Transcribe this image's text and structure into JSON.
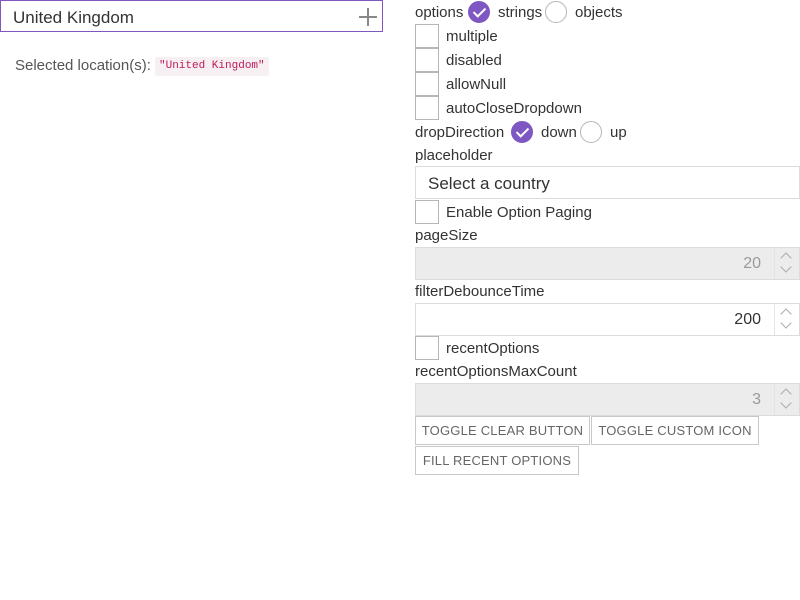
{
  "combobox": {
    "value": "United Kingdom",
    "add_icon": "plus-icon"
  },
  "selection": {
    "label": "Selected location(s):",
    "badge": "\"United Kingdom\""
  },
  "options": {
    "label": "options",
    "choices": [
      {
        "label": "strings",
        "checked": true
      },
      {
        "label": "objects",
        "checked": false
      }
    ]
  },
  "checkboxes": {
    "multiple": "multiple",
    "disabled": "disabled",
    "allowNull": "allowNull",
    "autoCloseDropdown": "autoCloseDropdown"
  },
  "dropDirection": {
    "label": "dropDirection",
    "choices": [
      {
        "label": "down",
        "checked": true
      },
      {
        "label": "up",
        "checked": false
      }
    ]
  },
  "placeholder": {
    "label": "placeholder",
    "value": "Select a country"
  },
  "paging": {
    "label": "Enable Option Paging",
    "checked": false
  },
  "pageSize": {
    "label": "pageSize",
    "value": "20",
    "disabled": true
  },
  "filterDebounceTime": {
    "label": "filterDebounceTime",
    "value": "200",
    "disabled": false
  },
  "recentOptions": {
    "label": "recentOptions",
    "checked": false
  },
  "recentOptionsMaxCount": {
    "label": "recentOptionsMaxCount",
    "value": "3",
    "disabled": true
  },
  "buttons": {
    "toggle_clear": "TOGGLE CLEAR BUTTON",
    "toggle_icon": "TOGGLE CUSTOM ICON",
    "fill_recent": "FILL RECENT OPTIONS"
  },
  "colors": {
    "accent": "#7e57c2",
    "badge_text": "#c2185b",
    "badge_bg": "#f6f0f2"
  }
}
